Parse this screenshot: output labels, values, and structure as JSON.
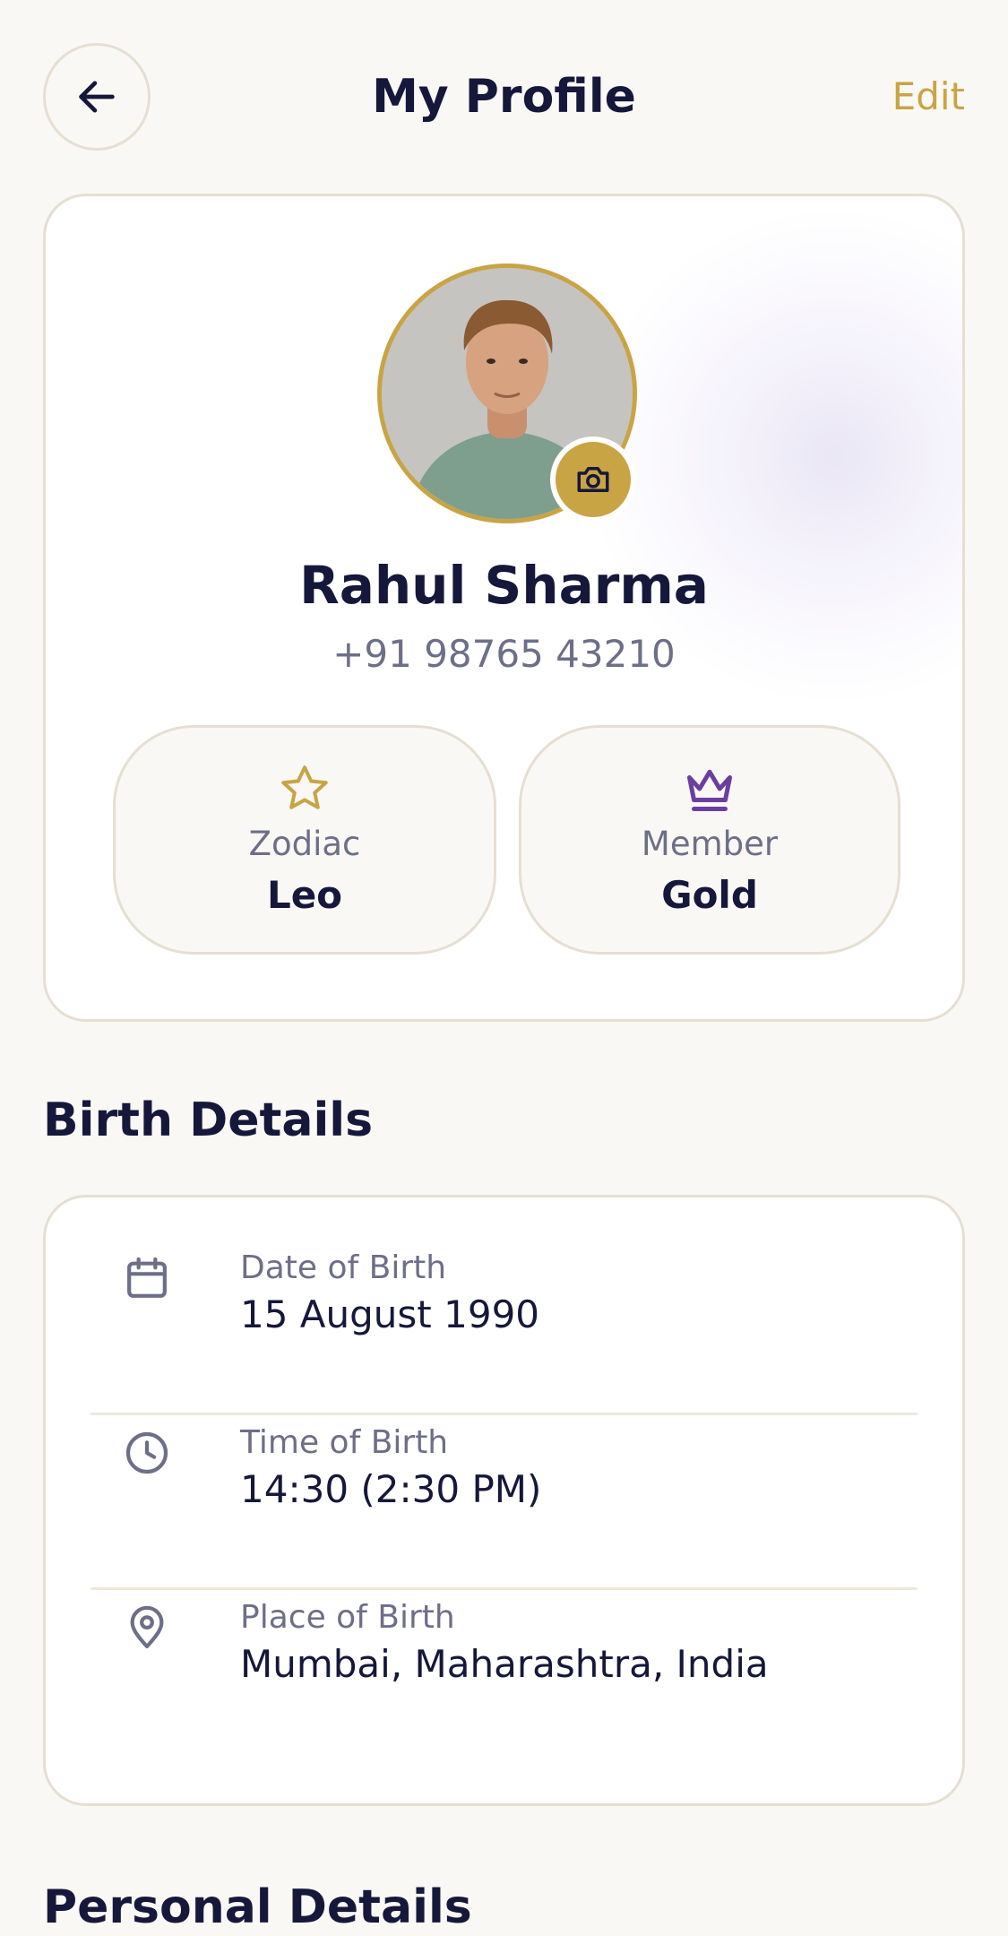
{
  "header": {
    "title": "My Profile",
    "edit_label": "Edit"
  },
  "profile": {
    "name": "Rahul Sharma",
    "phone": "+91 98765 43210",
    "stats": [
      {
        "label": "Zodiac",
        "value": "Leo",
        "icon": "star-icon"
      },
      {
        "label": "Member",
        "value": "Gold",
        "icon": "crown-icon"
      }
    ]
  },
  "birth_details": {
    "title": "Birth Details",
    "rows": [
      {
        "label": "Date of Birth",
        "value": "15 August 1990",
        "icon": "calendar-icon"
      },
      {
        "label": "Time of Birth",
        "value": "14:30 (2:30 PM)",
        "icon": "clock-icon"
      },
      {
        "label": "Place of Birth",
        "value": "Mumbai, Maharashtra, India",
        "icon": "map-pin-icon"
      }
    ]
  },
  "personal_details": {
    "title": "Personal Details"
  },
  "colors": {
    "accent_gold": "#C9A445",
    "accent_purple": "#6B3FA0",
    "text_primary": "#15183A",
    "text_muted": "#6D6F88",
    "background": "#FAF8F4",
    "border": "#E6DFD1"
  }
}
